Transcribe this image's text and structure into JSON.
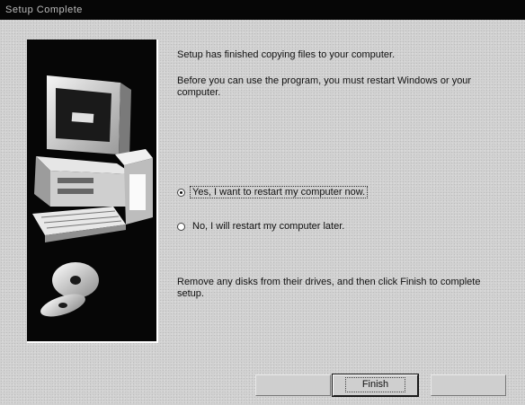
{
  "window": {
    "title": "Setup Complete"
  },
  "message": {
    "line1": "Setup has finished copying files to your computer.",
    "line2": "Before you can use the program, you must restart Windows or your computer.",
    "instruction": "Remove any disks from their drives, and then click Finish to complete setup."
  },
  "restart_options": [
    {
      "label": "Yes, I want to restart my computer now.",
      "selected": true
    },
    {
      "label": "No, I will restart my computer later.",
      "selected": false
    }
  ],
  "buttons": {
    "finish": "Finish"
  },
  "illustration": {
    "icon": "computer-and-disks-illustration"
  }
}
